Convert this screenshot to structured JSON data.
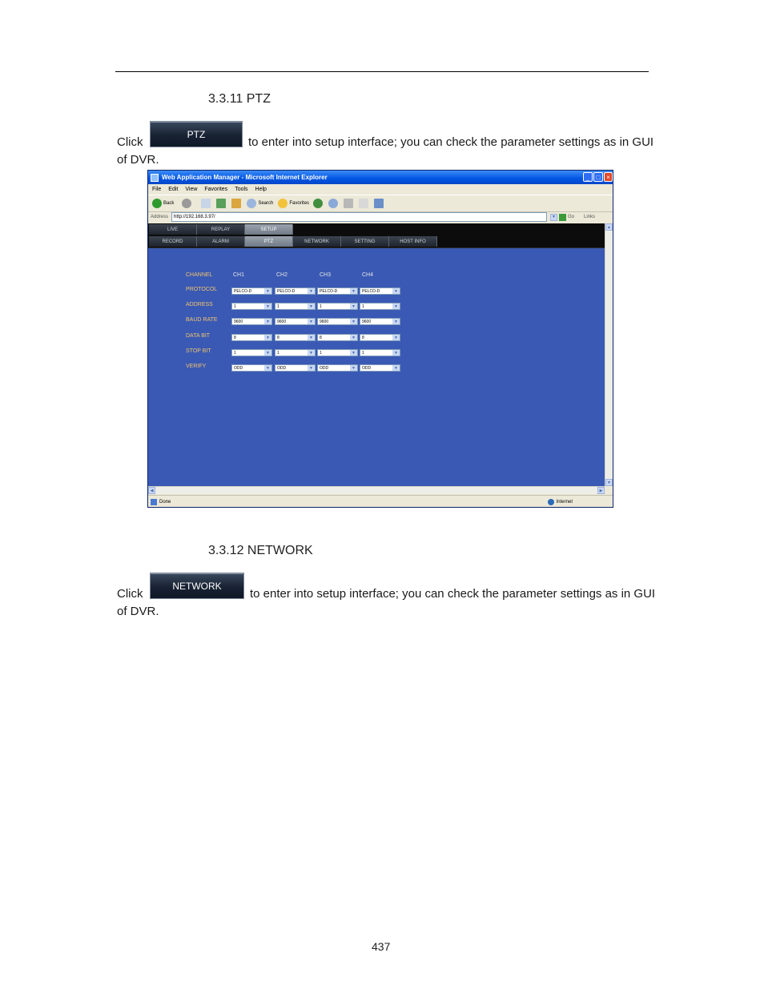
{
  "section1": {
    "heading": "3.3.11 PTZ",
    "click_word": "Click",
    "button_label": "PTZ",
    "sentence": "to enter into setup interface; you can check the parameter settings as in GUI",
    "sentence_end": "of DVR."
  },
  "browser": {
    "title": "Web Application Manager - Microsoft Internet Explorer",
    "menu": [
      "File",
      "Edit",
      "View",
      "Favorites",
      "Tools",
      "Help"
    ],
    "toolbar": {
      "back": "Back",
      "search": "Search",
      "favorites": "Favorites"
    },
    "address_label": "Address",
    "address_value": "http://192.168.3.97/",
    "go_label": "Go",
    "links_label": "Links",
    "status_left": "Done",
    "status_right": "Internet"
  },
  "dvr": {
    "main_tabs": [
      "LIVE",
      "REPLAY",
      "SETUP"
    ],
    "active_main_tab": "SETUP",
    "sub_tabs": [
      "RECORD",
      "ALARM",
      "PTZ",
      "NETWORK",
      "SETTING",
      "HOST INFO"
    ],
    "active_sub_tab": "PTZ",
    "channel_label": "CHANNEL",
    "channels": [
      "CH1",
      "CH2",
      "CH3",
      "CH4"
    ],
    "rows": [
      {
        "label": "PROTOCOL",
        "values": [
          "PELCO-D",
          "PELCO-D",
          "PELCO-D",
          "PELCO-D"
        ]
      },
      {
        "label": "ADDRESS",
        "values": [
          "1",
          "1",
          "1",
          "1"
        ]
      },
      {
        "label": "BAUD RATE",
        "values": [
          "9600",
          "9600",
          "9600",
          "9600"
        ]
      },
      {
        "label": "DATA BIT",
        "values": [
          "8",
          "8",
          "8",
          "8"
        ]
      },
      {
        "label": "STOP BIT",
        "values": [
          "1",
          "1",
          "1",
          "1"
        ]
      },
      {
        "label": "VERIFY",
        "values": [
          "ODD",
          "ODD",
          "ODD",
          "ODD"
        ]
      }
    ],
    "colors": {
      "background": "#3a59b4",
      "label": "#f0c36e"
    }
  },
  "section2": {
    "heading": "3.3.12 NETWORK",
    "click_word": "Click",
    "button_label": "NETWORK",
    "sentence": "to enter into setup interface; you can check the parameter settings as in GUI",
    "sentence_end": "of DVR."
  },
  "page_number": "437"
}
